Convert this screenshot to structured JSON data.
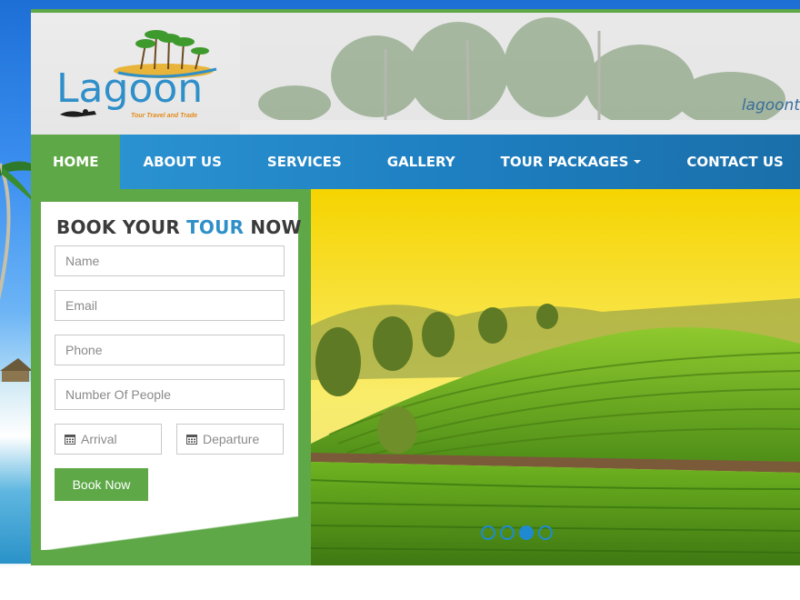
{
  "header": {
    "logo_text": "Lagoon",
    "logo_tagline": "Tour Travel and Trade",
    "email_partial": "lagoont"
  },
  "nav": {
    "items": [
      {
        "label": "HOME",
        "active": true
      },
      {
        "label": "ABOUT US",
        "active": false
      },
      {
        "label": "SERVICES",
        "active": false
      },
      {
        "label": "GALLERY",
        "active": false
      },
      {
        "label": "TOUR PACKAGES",
        "active": false,
        "dropdown": true
      },
      {
        "label": "CONTACT US",
        "active": false
      }
    ]
  },
  "booking": {
    "title_part1": "BOOK YOUR ",
    "title_highlight": "TOUR",
    "title_part2": " NOW",
    "name_placeholder": "Name",
    "email_placeholder": "Email",
    "phone_placeholder": "Phone",
    "people_placeholder": "Number Of People",
    "arrival_placeholder": "Arrival",
    "departure_placeholder": "Departure",
    "submit_label": "Book Now"
  },
  "slider": {
    "slide_count": 4,
    "active_index": 2
  },
  "colors": {
    "brand_green": "#5ea847",
    "brand_blue": "#2f8fc9",
    "nav_blue": "#1e7fc1"
  }
}
